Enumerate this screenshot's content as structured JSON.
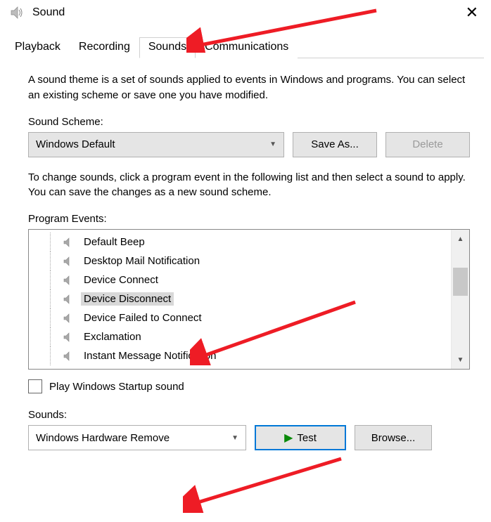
{
  "title": "Sound",
  "tabs": [
    "Playback",
    "Recording",
    "Sounds",
    "Communications"
  ],
  "active_tab": "Sounds",
  "description": "A sound theme is a set of sounds applied to events in Windows and programs.  You can select an existing scheme or save one you have modified.",
  "scheme_label": "Sound Scheme:",
  "scheme_value": "Windows Default",
  "save_as_label": "Save As...",
  "delete_label": "Delete",
  "change_desc": "To change sounds, click a program event in the following list and then select a sound to apply.  You can save the changes as a new sound scheme.",
  "events_label": "Program Events:",
  "events": [
    {
      "label": "Default Beep",
      "selected": false
    },
    {
      "label": "Desktop Mail Notification",
      "selected": false
    },
    {
      "label": "Device Connect",
      "selected": false
    },
    {
      "label": "Device Disconnect",
      "selected": true
    },
    {
      "label": "Device Failed to Connect",
      "selected": false
    },
    {
      "label": "Exclamation",
      "selected": false
    },
    {
      "label": "Instant Message Notification",
      "selected": false
    }
  ],
  "startup_checkbox": "Play Windows Startup sound",
  "sounds_label": "Sounds:",
  "sounds_value": "Windows Hardware Remove",
  "test_label": "Test",
  "browse_label": "Browse..."
}
